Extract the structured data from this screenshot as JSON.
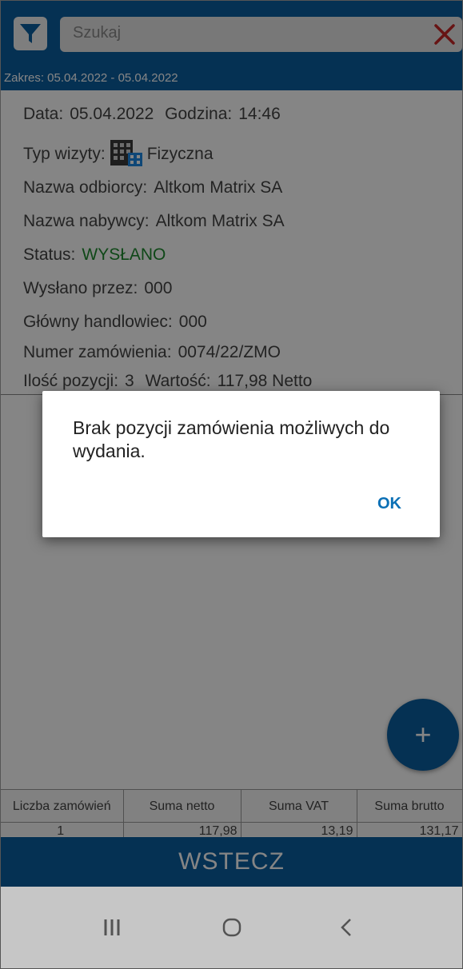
{
  "search": {
    "placeholder": "Szukaj"
  },
  "range": {
    "text": "Zakres: 05.04.2022 - 05.04.2022"
  },
  "details": {
    "date_label": "Data:",
    "date_value": "05.04.2022",
    "time_label": "Godzina:",
    "time_value": "14:46",
    "visit_type_label": "Typ wizyty:",
    "visit_type_value": "Fizyczna",
    "recipient_label": "Nazwa odbiorcy:",
    "recipient_value": "Altkom Matrix SA",
    "buyer_label": "Nazwa nabywcy:",
    "buyer_value": "Altkom Matrix SA",
    "status_label": "Status:",
    "status_value": "WYSŁANO",
    "sent_by_label": "Wysłano przez:",
    "sent_by_value": "000",
    "main_rep_label": "Główny handlowiec:",
    "main_rep_value": "000",
    "order_no_label": "Numer zamówienia:",
    "order_no_value": "0074/22/ZMO",
    "items_label": "Ilość pozycji:",
    "items_value": "3",
    "value_label": "Wartość:",
    "value_value": "117,98 Netto"
  },
  "fab": {
    "label": "+"
  },
  "summary": {
    "headers": [
      "Liczba zamówień",
      "Suma netto",
      "Suma VAT",
      "Suma brutto"
    ],
    "values": [
      "1",
      "117,98",
      "13,19",
      "131,17"
    ]
  },
  "back_button": {
    "label": "WSTECZ"
  },
  "dialog": {
    "message": "Brak pozycji zamówienia możliwych do wydania.",
    "ok_label": "OK"
  },
  "colors": {
    "primary": "#0a5ea0",
    "status_green": "#1e8a2e",
    "clear_red": "#c62828"
  },
  "icons": [
    "filter-icon",
    "close-icon",
    "building-icon",
    "recent-apps-icon",
    "home-icon",
    "back-icon"
  ]
}
